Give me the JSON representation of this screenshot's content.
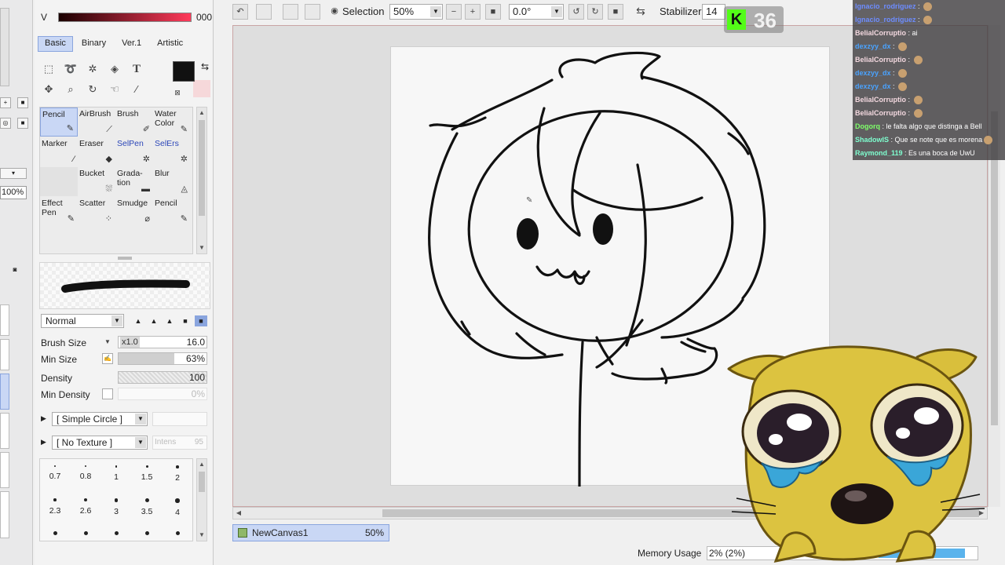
{
  "color_panel": {
    "channel_label": "V",
    "channel_value": "000"
  },
  "tabs": [
    {
      "label": "Basic",
      "active": true
    },
    {
      "label": "Binary",
      "active": false
    },
    {
      "label": "Ver.1",
      "active": false
    },
    {
      "label": "Artistic",
      "active": false
    }
  ],
  "tools": {
    "text_tool_glyph": "T"
  },
  "brushes": [
    {
      "label": "Pencil",
      "selected": true,
      "icon": "pencil-icon",
      "color": ""
    },
    {
      "label": "AirBrush",
      "selected": false,
      "icon": "airbrush-icon",
      "color": ""
    },
    {
      "label": "Brush",
      "selected": false,
      "icon": "brush-icon",
      "color": ""
    },
    {
      "label": "Water Color",
      "selected": false,
      "icon": "watercolor-icon",
      "color": ""
    },
    {
      "label": "Marker",
      "selected": false,
      "icon": "marker-icon",
      "color": ""
    },
    {
      "label": "Eraser",
      "selected": false,
      "icon": "eraser-icon",
      "color": ""
    },
    {
      "label": "SelPen",
      "selected": false,
      "icon": "selpen-icon",
      "color": "#2b46b8"
    },
    {
      "label": "SelErs",
      "selected": false,
      "icon": "selers-icon",
      "color": "#2b46b8"
    },
    {
      "label": "",
      "selected": false,
      "icon": "",
      "color": ""
    },
    {
      "label": "Bucket",
      "selected": false,
      "icon": "bucket-icon",
      "color": ""
    },
    {
      "label": "Grada- tion",
      "selected": false,
      "icon": "gradation-icon",
      "color": ""
    },
    {
      "label": "Blur",
      "selected": false,
      "icon": "blur-icon",
      "color": ""
    },
    {
      "label": "Effect Pen",
      "selected": false,
      "icon": "effect-pen-icon",
      "color": ""
    },
    {
      "label": "Scatter",
      "selected": false,
      "icon": "scatter-icon",
      "color": ""
    },
    {
      "label": "Smudge",
      "selected": false,
      "icon": "smudge-icon",
      "color": ""
    },
    {
      "label": "Pencil",
      "selected": false,
      "icon": "pencil-icon",
      "color": ""
    }
  ],
  "blend": {
    "mode": "Normal"
  },
  "params": {
    "brush_size_label": "Brush Size",
    "brush_size_multiplier": "x1.0",
    "brush_size_value": "16.0",
    "min_size_label": "Min Size",
    "min_size_value": "63%",
    "min_size_level": 0.63,
    "density_label": "Density",
    "density_value": "100",
    "min_density_label": "Min Density",
    "min_density_value": "0%"
  },
  "shape": {
    "circle": "[ Simple Circle ]",
    "texture": "[ No Texture ]",
    "intensity_label": "Intens",
    "intensity_value": "95"
  },
  "sizes": [
    "0.7",
    "0.8",
    "1",
    "1.5",
    "2",
    "2.3",
    "2.6",
    "3",
    "3.5",
    "4"
  ],
  "left_strip": {
    "zoom": "100%"
  },
  "toolbar": {
    "selection_label": "Selection",
    "zoom_value": "50%",
    "rotation_value": "0.0°",
    "stabilizer_label": "Stabilizer",
    "stabilizer_value": "14"
  },
  "file_tab": {
    "name": "NewCanvas1",
    "zoom": "50%"
  },
  "memory": {
    "label": "Memory Usage",
    "value": "2% (2%)"
  },
  "badge": {
    "logo": "K",
    "count": "36"
  },
  "chat": [
    {
      "user": "Ignacio_rodriguez",
      "text": "",
      "color": "#6d8cff",
      "emote": true
    },
    {
      "user": "Ignacio_rodriguez",
      "text": "",
      "color": "#6d8cff",
      "emote": true
    },
    {
      "user": "BelialCorruptio",
      "text": "ai",
      "color": "#f4d9e0",
      "emote": false
    },
    {
      "user": "dexzyy_dx",
      "text": "",
      "color": "#4aa3ff",
      "emote": true
    },
    {
      "user": "BelialCorruptio",
      "text": "",
      "color": "#f4d9e0",
      "emote": true
    },
    {
      "user": "dexzyy_dx",
      "text": "",
      "color": "#4aa3ff",
      "emote": true
    },
    {
      "user": "dexzyy_dx",
      "text": "",
      "color": "#4aa3ff",
      "emote": true
    },
    {
      "user": "BelialCorruptio",
      "text": "",
      "color": "#f4d9e0",
      "emote": true
    },
    {
      "user": "BelialCorruptio",
      "text": "",
      "color": "#f4d9e0",
      "emote": true
    },
    {
      "user": "Dogorq",
      "text": "le falta algo que distinga a Bell",
      "color": "#7fff6a",
      "emote": false
    },
    {
      "user": "ShadowlS",
      "text": "Que se note que es morena",
      "color": "#7fffd0",
      "emote": true
    },
    {
      "user": "Raymond_119",
      "text": "Es una boca de UwU",
      "color": "#7fffd0",
      "emote": false
    }
  ]
}
